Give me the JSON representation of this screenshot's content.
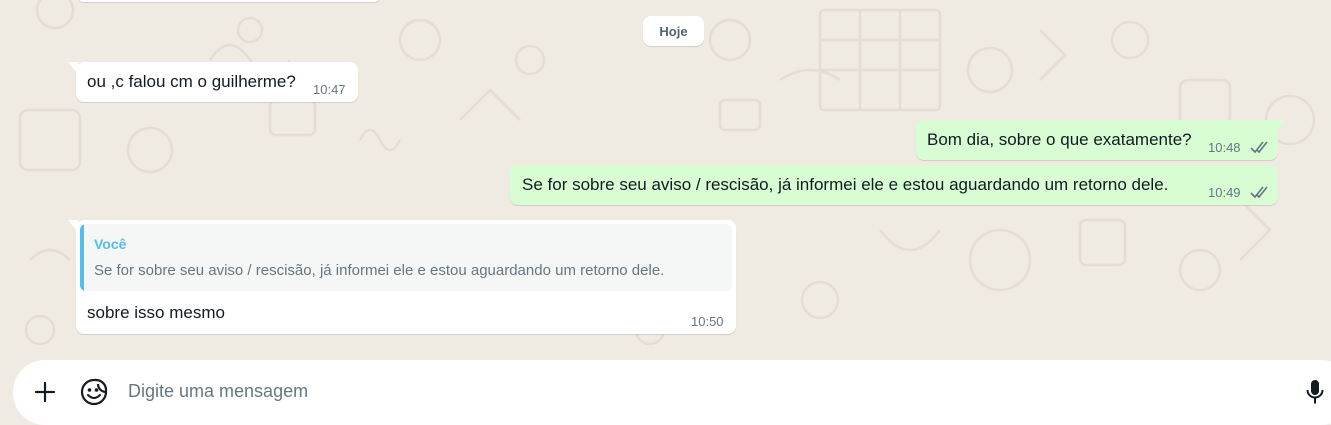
{
  "date_separator": "Hoje",
  "messages": [
    {
      "direction": "in",
      "text": "ou ,c falou cm o guilherme?",
      "time": "10:47"
    },
    {
      "direction": "out",
      "text": "Bom dia, sobre o que exatamente?",
      "time": "10:48",
      "status": "read"
    },
    {
      "direction": "out",
      "text": "Se for sobre seu aviso / rescisão, já informei ele e estou aguardando um retorno dele.",
      "time": "10:49",
      "status": "read"
    },
    {
      "direction": "in",
      "quoted": {
        "author": "Você",
        "text": "Se for sobre seu aviso / rescisão, já informei ele e estou aguardando um retorno dele."
      },
      "text": "sobre isso mesmo",
      "time": "10:50"
    }
  ],
  "composer": {
    "placeholder": "Digite uma mensagem",
    "attach_icon": "plus-icon",
    "sticker_icon": "sticker-icon",
    "mic_icon": "microphone-icon"
  },
  "colors": {
    "background": "#efeae2",
    "incoming_bubble": "#ffffff",
    "outgoing_bubble": "#d9fdd3",
    "read_ticks": "#667781",
    "quote_accent": "#53bdeb"
  }
}
